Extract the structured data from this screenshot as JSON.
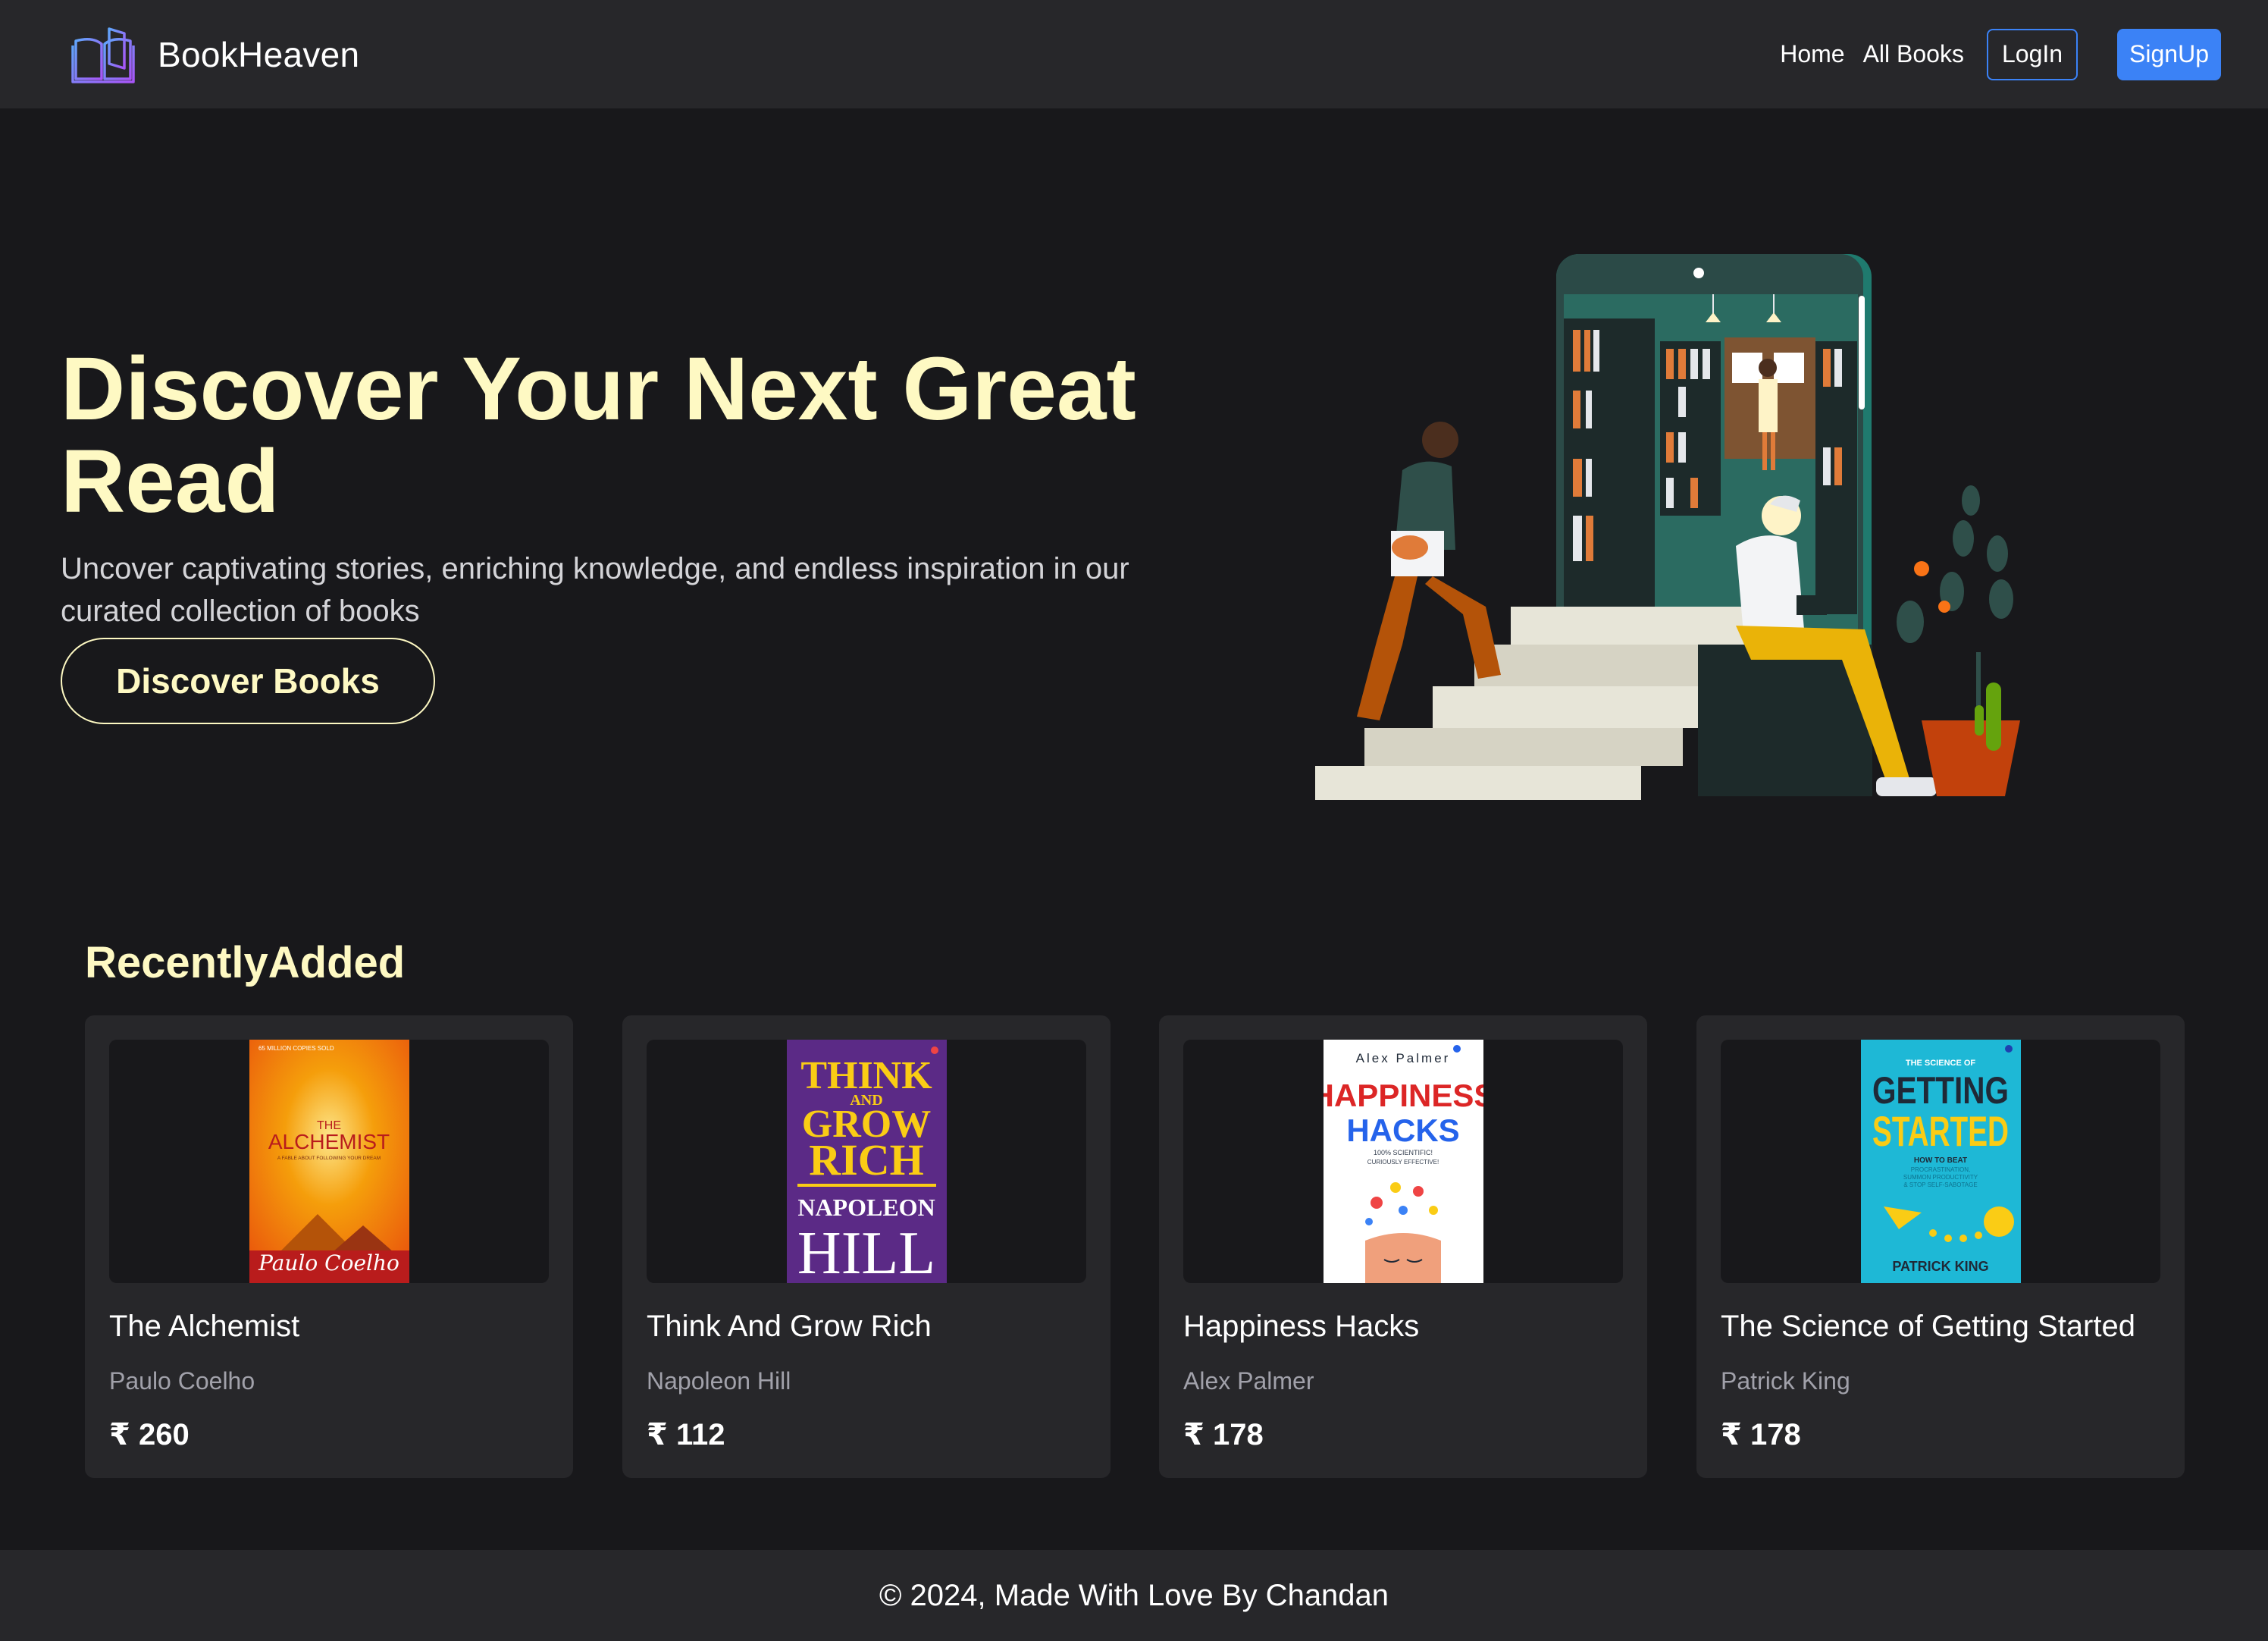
{
  "navbar": {
    "brand": "BookHeaven",
    "links": [
      "Home",
      "All Books"
    ],
    "login_label": "LogIn",
    "signup_label": "SignUp"
  },
  "hero": {
    "title": "Discover Your Next Great Read",
    "subtitle": "Uncover captivating stories, enriching knowledge, and endless inspiration in our curated collection of books",
    "cta_label": "Discover Books"
  },
  "recent": {
    "title": "RecentlyAdded",
    "books": [
      {
        "title": "The Alchemist",
        "author": "Paulo Coelho",
        "price": "₹ 260",
        "cover": {
          "banner": "65 MILLION COPIES SOLD",
          "top": "THE",
          "main": "ALCHEMIST",
          "tagline": "A FABLE ABOUT FOLLOWING YOUR DREAM",
          "signature": "Paulo Coelho"
        }
      },
      {
        "title": "Think And Grow Rich",
        "author": "Napoleon Hill",
        "price": "₹ 112",
        "cover": {
          "line1": "THINK",
          "line2": "AND",
          "line3": "GROW",
          "line4": "RICH",
          "author1": "NAPOLEON",
          "author2": "HILL"
        }
      },
      {
        "title": "Happiness Hacks",
        "author": "Alex Palmer",
        "price": "₹ 178",
        "cover": {
          "author": "Alex Palmer",
          "line1": "HAPPINESS",
          "line2": "HACKS",
          "tag1": "100% SCIENTIFIC!",
          "tag2": "CURIOUSLY EFFECTIVE!"
        }
      },
      {
        "title": "The Science of Getting Started",
        "author": "Patrick King",
        "price": "₹ 178",
        "cover": {
          "top": "THE SCIENCE OF",
          "line1": "GETTING",
          "line2": "STARTED",
          "sub1": "HOW TO BEAT",
          "sub2": "PROCRASTINATION,",
          "sub3": "SUMMON PRODUCTIVITY",
          "sub4": "& STOP SELF-SABOTAGE",
          "author": "PATRICK KING"
        }
      }
    ]
  },
  "footer": {
    "text": "© 2024, Made With Love By Chandan"
  }
}
